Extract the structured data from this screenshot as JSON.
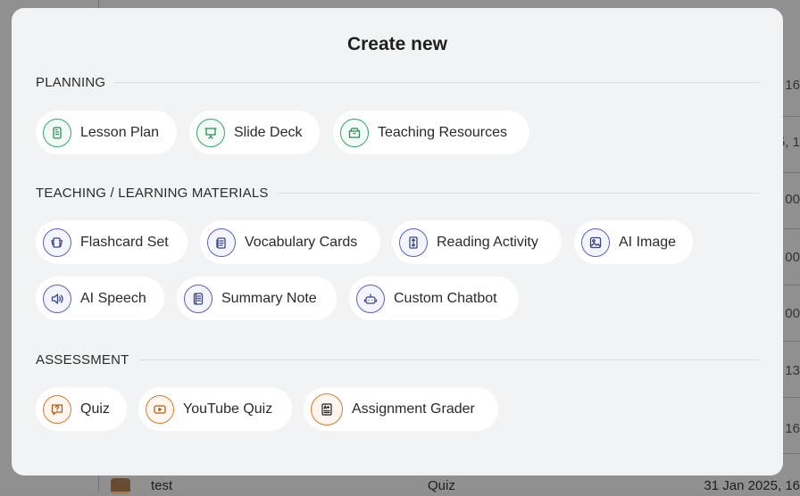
{
  "background": {
    "dates": [
      ", 16",
      "5, 1",
      ", 00",
      ", 00",
      ", 00",
      ", 13",
      ", 16"
    ],
    "last_row": {
      "name": "test",
      "type": "Quiz",
      "date": "31 Jan 2025, 16"
    }
  },
  "modal": {
    "title": "Create new",
    "sections": {
      "planning": {
        "label": "PLANNING",
        "items": [
          "Lesson Plan",
          "Slide Deck",
          "Teaching Resources"
        ]
      },
      "materials": {
        "label": "TEACHING / LEARNING MATERIALS",
        "items": [
          "Flashcard Set",
          "Vocabulary Cards",
          "Reading Activity",
          "AI Image",
          "AI Speech",
          "Summary Note",
          "Custom Chatbot"
        ]
      },
      "assessment": {
        "label": "ASSESSMENT",
        "items": [
          "Quiz",
          "YouTube Quiz",
          "Assignment Grader"
        ]
      }
    }
  },
  "colors": {
    "planning": "#3aa46a",
    "materials": "#5a62b8",
    "assessment": "#d67a33"
  },
  "icons": {
    "planning": [
      "document-icon",
      "presentation-board-icon",
      "box-icon"
    ],
    "materials": [
      "flashcards-icon",
      "vocabulary-cards-icon",
      "reading-icon",
      "image-icon",
      "speaker-icon",
      "notebook-icon",
      "robot-icon"
    ],
    "assessment": [
      "quiz-bubble-icon",
      "video-play-icon",
      "grade-sheet-icon"
    ]
  }
}
